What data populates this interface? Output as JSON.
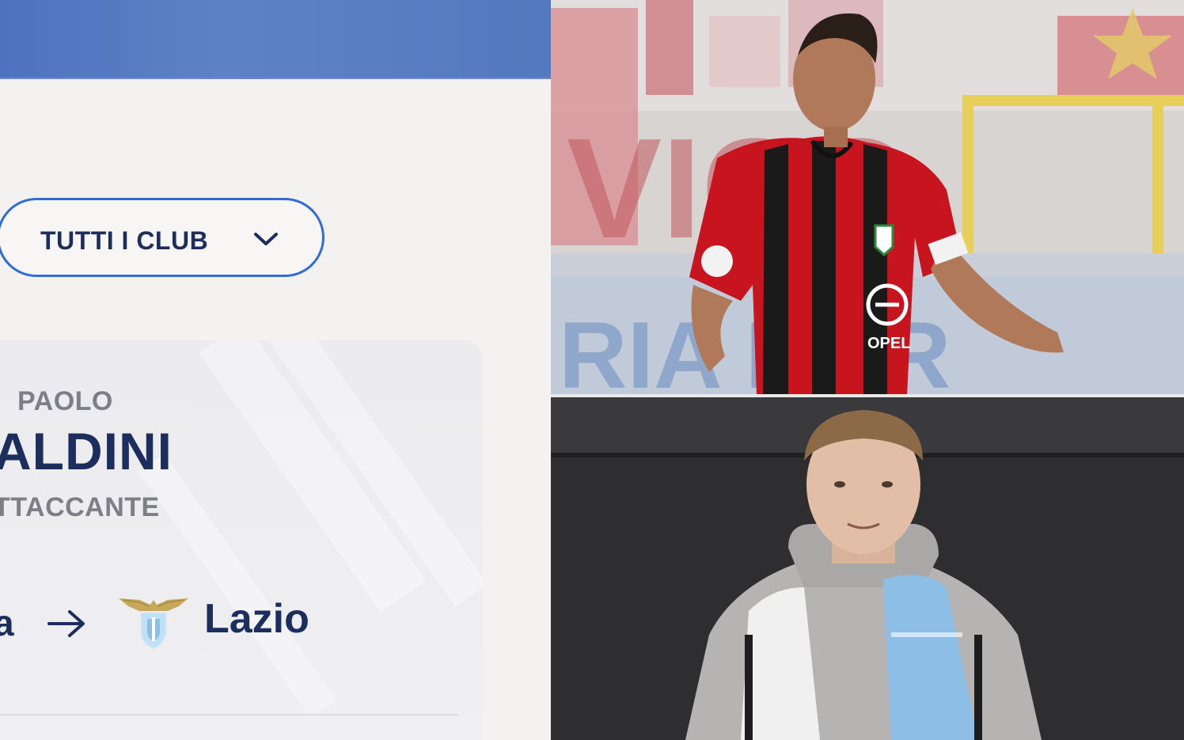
{
  "club_filter": {
    "label": "TUTTI I CLUB"
  },
  "player": {
    "first_name": "PAOLO",
    "last_name": "ALDINI",
    "role": "TTACCANTE"
  },
  "transfer": {
    "from_fragment": "a",
    "to_club": "Lazio"
  },
  "colors": {
    "header_blue": "#5379c0",
    "navy_text": "#1c2e5e",
    "button_border": "#2f6cd6",
    "gray_text": "#7e7f86",
    "milan_red": "#c8141e",
    "lazio_sky": "#8dbfe6"
  },
  "icons": {
    "dropdown": "chevron-down-icon",
    "arrow": "arrow-right-icon",
    "crest": "lazio-crest-icon"
  }
}
